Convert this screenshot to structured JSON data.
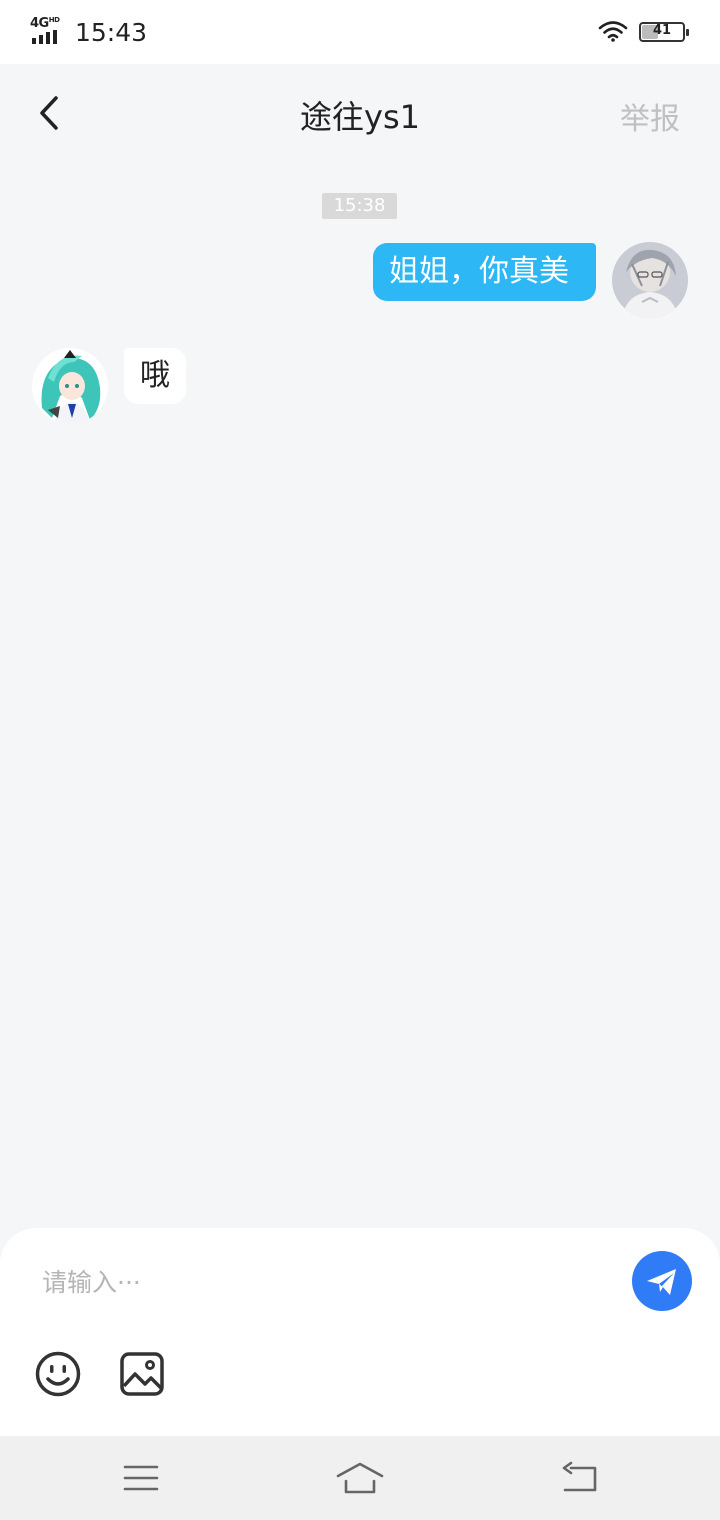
{
  "status_bar": {
    "network": "4G",
    "network_sup": "HD",
    "time": "15:43",
    "battery": "41",
    "battery_level": 0.41
  },
  "header": {
    "title": "途往ys1",
    "report_label": "举报"
  },
  "chat": {
    "timestamp": "15:38",
    "messages": [
      {
        "side": "right",
        "text": "姐姐，你真美"
      },
      {
        "side": "left",
        "text": "哦"
      }
    ]
  },
  "composer": {
    "placeholder": "请输入···",
    "value": ""
  },
  "colors": {
    "accent": "#2f7cf6",
    "bubble_sent": "#2db7f5",
    "background": "#f5f6f8"
  }
}
